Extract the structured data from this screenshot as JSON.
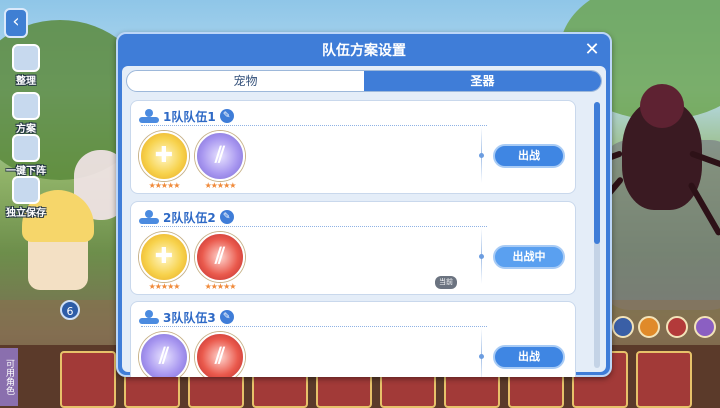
{
  "sidebar": {
    "back": "‹",
    "items": [
      {
        "label": "整理"
      },
      {
        "label": "方案"
      },
      {
        "label": "一键下阵"
      },
      {
        "label": "独立保存"
      }
    ],
    "bottom_tag": "可用角色",
    "circle_number": "6"
  },
  "dialog": {
    "title": "队伍方案设置",
    "close": "✕",
    "tabs": [
      {
        "label": "宠物",
        "active": false
      },
      {
        "label": "圣器",
        "active": true
      }
    ],
    "teams": [
      {
        "name": "1队队伍1",
        "relics": [
          {
            "icon": "holy-cross-icon",
            "color": "gold",
            "stars": "★★★★★"
          },
          {
            "icon": "claw-slash-icon",
            "color": "purple",
            "stars": "★★★★★"
          }
        ],
        "button": "出战",
        "in_battle": false
      },
      {
        "name": "2队队伍2",
        "relics": [
          {
            "icon": "holy-cross-icon",
            "color": "gold",
            "stars": "★★★★★"
          },
          {
            "icon": "fire-claw-icon",
            "color": "red",
            "stars": "★★★★★"
          }
        ],
        "button": "出战中",
        "in_battle": true,
        "badge": "当前"
      },
      {
        "name": "3队队伍3",
        "relics": [
          {
            "icon": "claw-slash-icon",
            "color": "purple",
            "stars": "★★★★★"
          },
          {
            "icon": "fire-claw-icon",
            "color": "red",
            "stars": "★★★★★"
          }
        ],
        "button": "出战",
        "in_battle": false
      }
    ]
  },
  "colors": {
    "dialog_blue": "#3f7dd8",
    "panel_bg": "#e4edf8",
    "star_orange": "#f08a3a"
  }
}
